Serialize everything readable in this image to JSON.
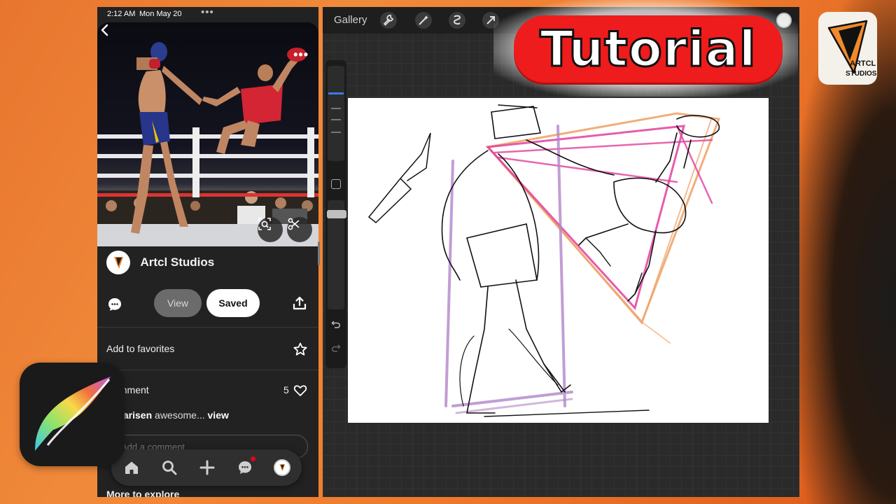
{
  "status_bar": {
    "time": "2:12 AM",
    "date": "Mon May 20"
  },
  "pin": {
    "creator_name": "Artcl Studios",
    "view_label": "View",
    "saved_label": "Saved",
    "favorites_label": "Add to favorites",
    "comment_title": "Comment",
    "likes_count": "5",
    "comment_user": "arisen",
    "comment_preview": "awesome...",
    "comment_view": "view",
    "add_comment_placeholder": "Add a comment",
    "more_to_explore": "More to explore"
  },
  "procreate": {
    "gallery_label": "Gallery",
    "toolbar_icons": [
      "wrench-icon",
      "magic-wand-icon",
      "selection-icon",
      "transform-arrow-icon"
    ]
  },
  "overlay": {
    "tutorial_label": "Tutorial",
    "brand_text_top": "ARTCL",
    "brand_text_bottom": "STUDIOS"
  },
  "colors": {
    "background": "#ee7a2c",
    "tutorial_red": "#ee1c1c",
    "pinterest_red": "#e60023",
    "active_blue": "#3a7ce8",
    "sketch_pink": "#e2409b",
    "sketch_orange": "#f0a064",
    "sketch_purple": "#b286c8"
  }
}
